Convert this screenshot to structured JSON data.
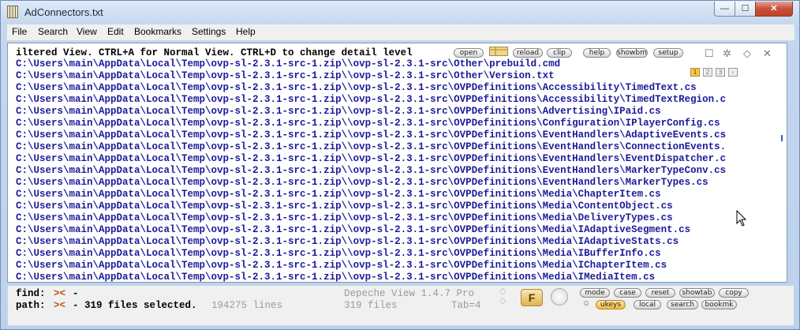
{
  "window": {
    "title": "AdConnectors.txt",
    "controls": {
      "minimize": "—",
      "maximize": "☐",
      "close": "✕"
    }
  },
  "menu": [
    "File",
    "Search",
    "View",
    "Edit",
    "Bookmarks",
    "Settings",
    "Help"
  ],
  "editor": {
    "header": "iltered View. CTRL+A for Normal View. CTRL+D to change detail level",
    "toolbar": [
      "open",
      "reload",
      "clip",
      "help",
      "showbm",
      "setup"
    ],
    "pages": [
      "1",
      "2",
      "3"
    ],
    "lines": [
      "C:\\Users\\main\\AppData\\Local\\Temp\\ovp-sl-2.3.1-src-1.zip\\\\ovp-sl-2.3.1-src\\Other\\prebuild.cmd",
      "C:\\Users\\main\\AppData\\Local\\Temp\\ovp-sl-2.3.1-src-1.zip\\\\ovp-sl-2.3.1-src\\Other\\Version.txt",
      "C:\\Users\\main\\AppData\\Local\\Temp\\ovp-sl-2.3.1-src-1.zip\\\\ovp-sl-2.3.1-src\\OVPDefinitions\\Accessibility\\TimedText.cs",
      "C:\\Users\\main\\AppData\\Local\\Temp\\ovp-sl-2.3.1-src-1.zip\\\\ovp-sl-2.3.1-src\\OVPDefinitions\\Accessibility\\TimedTextRegion.c",
      "C:\\Users\\main\\AppData\\Local\\Temp\\ovp-sl-2.3.1-src-1.zip\\\\ovp-sl-2.3.1-src\\OVPDefinitions\\Advertising\\IPaid.cs",
      "C:\\Users\\main\\AppData\\Local\\Temp\\ovp-sl-2.3.1-src-1.zip\\\\ovp-sl-2.3.1-src\\OVPDefinitions\\Configuration\\IPlayerConfig.cs",
      "C:\\Users\\main\\AppData\\Local\\Temp\\ovp-sl-2.3.1-src-1.zip\\\\ovp-sl-2.3.1-src\\OVPDefinitions\\EventHandlers\\AdaptiveEvents.cs",
      "C:\\Users\\main\\AppData\\Local\\Temp\\ovp-sl-2.3.1-src-1.zip\\\\ovp-sl-2.3.1-src\\OVPDefinitions\\EventHandlers\\ConnectionEvents.",
      "C:\\Users\\main\\AppData\\Local\\Temp\\ovp-sl-2.3.1-src-1.zip\\\\ovp-sl-2.3.1-src\\OVPDefinitions\\EventHandlers\\EventDispatcher.c",
      "C:\\Users\\main\\AppData\\Local\\Temp\\ovp-sl-2.3.1-src-1.zip\\\\ovp-sl-2.3.1-src\\OVPDefinitions\\EventHandlers\\MarkerTypeConv.cs",
      "C:\\Users\\main\\AppData\\Local\\Temp\\ovp-sl-2.3.1-src-1.zip\\\\ovp-sl-2.3.1-src\\OVPDefinitions\\EventHandlers\\MarkerTypes.cs",
      "C:\\Users\\main\\AppData\\Local\\Temp\\ovp-sl-2.3.1-src-1.zip\\\\ovp-sl-2.3.1-src\\OVPDefinitions\\Media\\ChapterItem.cs",
      "C:\\Users\\main\\AppData\\Local\\Temp\\ovp-sl-2.3.1-src-1.zip\\\\ovp-sl-2.3.1-src\\OVPDefinitions\\Media\\ContentObject.cs",
      "C:\\Users\\main\\AppData\\Local\\Temp\\ovp-sl-2.3.1-src-1.zip\\\\ovp-sl-2.3.1-src\\OVPDefinitions\\Media\\DeliveryTypes.cs",
      "C:\\Users\\main\\AppData\\Local\\Temp\\ovp-sl-2.3.1-src-1.zip\\\\ovp-sl-2.3.1-src\\OVPDefinitions\\Media\\IAdaptiveSegment.cs",
      "C:\\Users\\main\\AppData\\Local\\Temp\\ovp-sl-2.3.1-src-1.zip\\\\ovp-sl-2.3.1-src\\OVPDefinitions\\Media\\IAdaptiveStats.cs",
      "C:\\Users\\main\\AppData\\Local\\Temp\\ovp-sl-2.3.1-src-1.zip\\\\ovp-sl-2.3.1-src\\OVPDefinitions\\Media\\IBufferInfo.cs",
      "C:\\Users\\main\\AppData\\Local\\Temp\\ovp-sl-2.3.1-src-1.zip\\\\ovp-sl-2.3.1-src\\OVPDefinitions\\Media\\IChapterItem.cs",
      "C:\\Users\\main\\AppData\\Local\\Temp\\ovp-sl-2.3.1-src-1.zip\\\\ovp-sl-2.3.1-src\\OVPDefinitions\\Media\\IMediaItem.cs"
    ]
  },
  "status": {
    "find_label": "find:",
    "find_value": "-",
    "path_label": "path:",
    "path_value": "- 319 files selected.",
    "lines_count": "194275 lines",
    "app_name": "Depeche View 1.4.7 Pro",
    "files_count": "319 files",
    "tab": "Tab=4",
    "f_button": "F",
    "buttons_row1": [
      "mode",
      "case",
      "reset",
      "showtab",
      "copy"
    ],
    "buttons_row2": [
      "ukeys",
      "local",
      "search",
      "bookmk"
    ]
  },
  "colors": {
    "path_text": "#1b1b9a",
    "accent_orange": "#f4b93b"
  }
}
